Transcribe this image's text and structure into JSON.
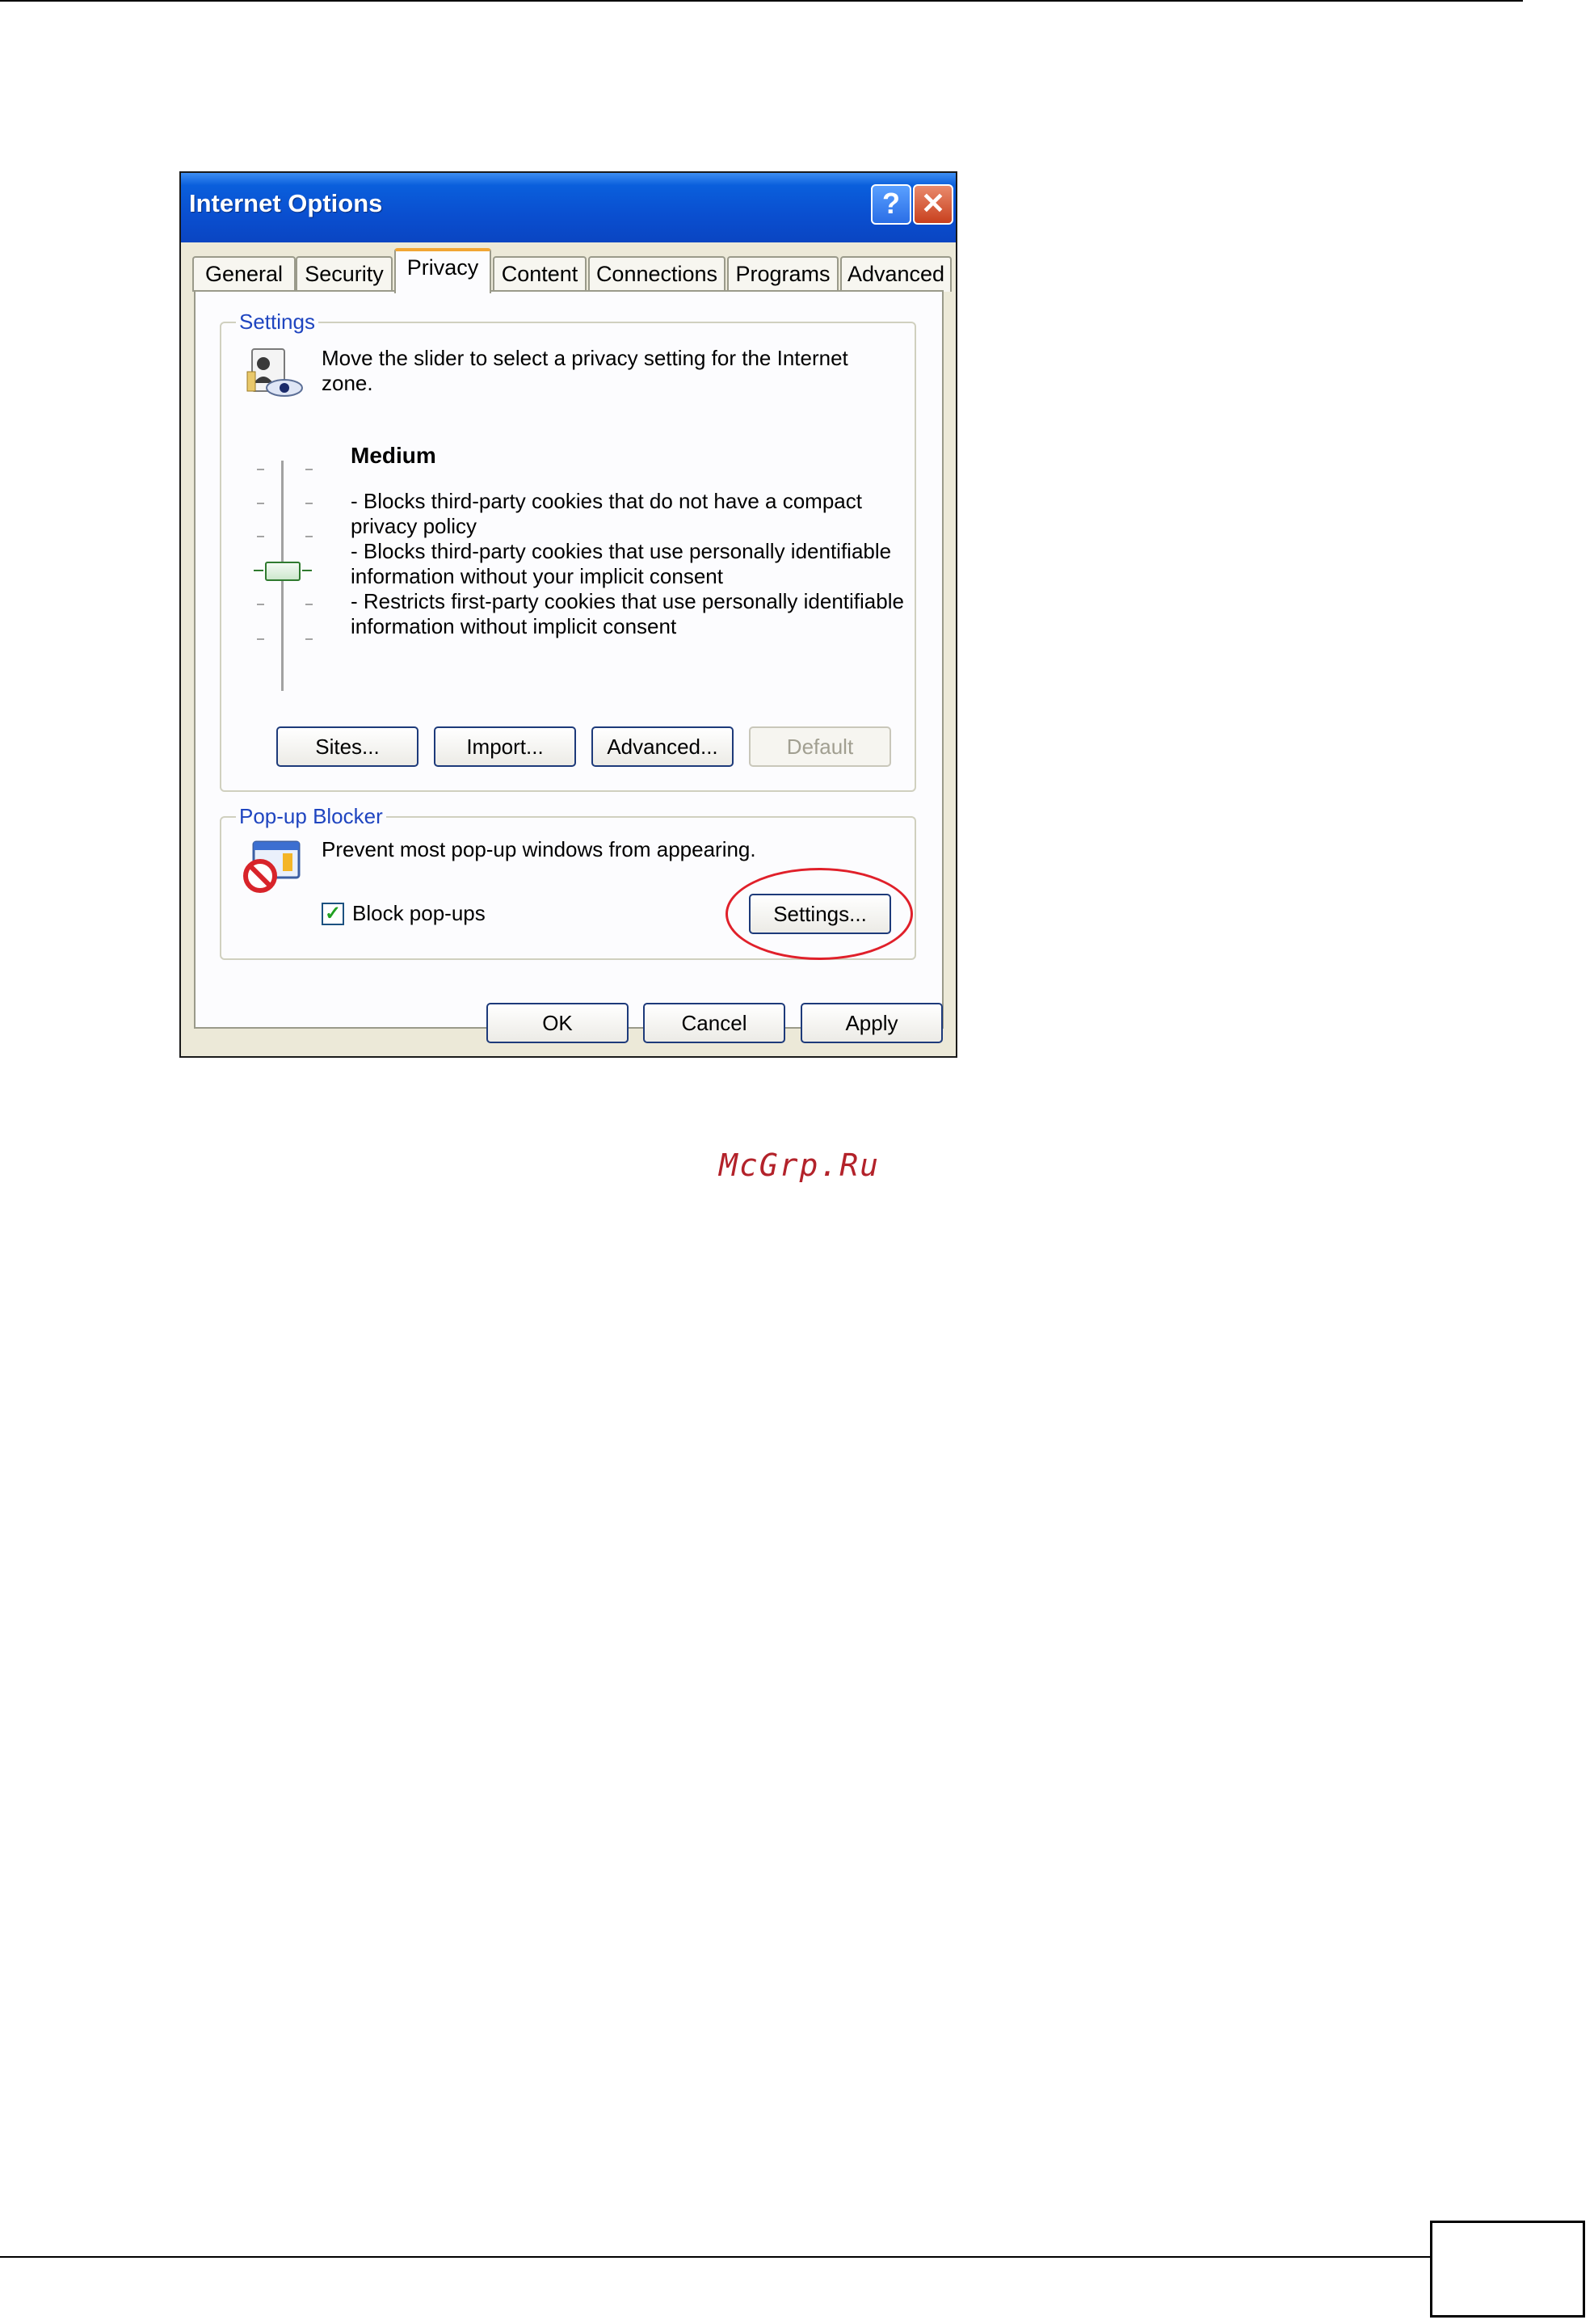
{
  "dialog": {
    "title": "Internet Options",
    "help_icon": "help-icon",
    "close_icon": "close-icon",
    "help_glyph": "?",
    "close_glyph": "✕",
    "tabs": [
      {
        "label": "General"
      },
      {
        "label": "Security"
      },
      {
        "label": "Privacy",
        "active": true
      },
      {
        "label": "Content"
      },
      {
        "label": "Connections"
      },
      {
        "label": "Programs"
      },
      {
        "label": "Advanced"
      }
    ],
    "settings": {
      "group_label": "Settings",
      "icon": "privacy-icon",
      "description": "Move the slider to select a privacy setting for the Internet zone.",
      "slider_value": "Medium",
      "level_title": "Medium",
      "level_details": [
        "- Blocks third-party cookies that do not have a compact privacy policy",
        "- Blocks third-party cookies that use personally identifiable information without your implicit consent",
        "- Restricts first-party cookies that use personally identifiable information without implicit consent"
      ],
      "buttons": {
        "sites": "Sites...",
        "import": "Import...",
        "advanced": "Advanced...",
        "default": "Default"
      }
    },
    "popup_blocker": {
      "group_label": "Pop-up Blocker",
      "icon": "popup-blocker-icon",
      "description": "Prevent most pop-up windows from appearing.",
      "checkbox_label": "Block pop-ups",
      "checkbox_checked": true,
      "check_glyph": "✓",
      "settings_button": "Settings..."
    },
    "footer": {
      "ok": "OK",
      "cancel": "Cancel",
      "apply": "Apply"
    }
  },
  "watermark": "McGrp.Ru",
  "colors": {
    "titlebar": "#0a4fd0",
    "annotation": "#e0202a",
    "group_label": "#1f45c0",
    "tab_highlight": "#f1a634"
  }
}
